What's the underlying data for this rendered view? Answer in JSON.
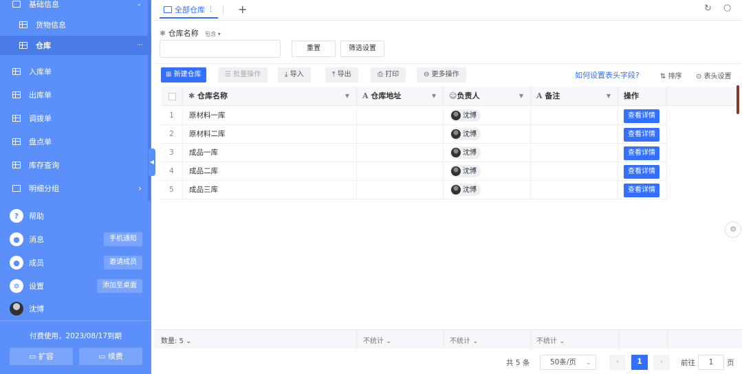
{
  "sidebar": {
    "section_title": "基础信息",
    "items": [
      {
        "label": "货物信息"
      },
      {
        "label": "仓库",
        "more": "···"
      },
      {
        "label": "入库单"
      },
      {
        "label": "出库单"
      },
      {
        "label": "调拨单"
      },
      {
        "label": "盘点单"
      },
      {
        "label": "库存查询"
      },
      {
        "label": "明细分组"
      }
    ],
    "bottom": [
      {
        "label": "帮助",
        "icon": "?"
      },
      {
        "label": "消息",
        "action": "手机通知"
      },
      {
        "label": "成员",
        "action": "邀请成员"
      },
      {
        "label": "设置",
        "action": "添加至桌面"
      },
      {
        "label": "沈博"
      }
    ],
    "subscription": "付费使用，2023/08/17到期",
    "expand": "扩容",
    "renew": "续费"
  },
  "tabs": {
    "active": "全部仓库",
    "add": "+"
  },
  "filter": {
    "field": "仓库名称",
    "operator": "包含",
    "reset": "重置",
    "settings": "筛选设置"
  },
  "toolbar": {
    "new": "新建仓库",
    "batch": "批量操作",
    "import": "导入",
    "export": "导出",
    "print": "打印",
    "more": "更多操作",
    "help_link": "如何设置表头字段?",
    "sort": "排序",
    "header_settings": "表头设置"
  },
  "table": {
    "columns": [
      "仓库名称",
      "仓库地址",
      "负责人",
      "备注",
      "操作"
    ],
    "rows": [
      {
        "no": "1",
        "name": "原材料一库",
        "owner": "沈博",
        "action": "查看详情"
      },
      {
        "no": "2",
        "name": "原材料二库",
        "owner": "沈博",
        "action": "查看详情"
      },
      {
        "no": "3",
        "name": "成品一库",
        "owner": "沈博",
        "action": "查看详情"
      },
      {
        "no": "4",
        "name": "成品二库",
        "owner": "沈博",
        "action": "查看详情"
      },
      {
        "no": "5",
        "name": "成品三库",
        "owner": "沈博",
        "action": "查看详情"
      }
    ],
    "summary": {
      "count": "数量: 5",
      "addr": "不统计",
      "owner": "不统计",
      "remark": "不统计"
    }
  },
  "pager": {
    "total": "共 5 条",
    "page_size": "50条/页",
    "current": "1",
    "goto": "前往",
    "goto_value": "1",
    "page_unit": "页"
  }
}
